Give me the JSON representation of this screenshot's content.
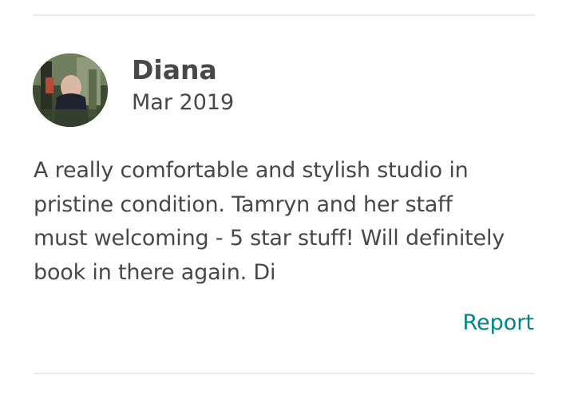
{
  "review": {
    "reviewer_name": "Diana",
    "date": "Mar 2019",
    "text_lines": [
      "A really comfortable and stylish studio in",
      "pristine condition. Tamryn and her staff",
      "must welcoming - 5 star stuff!  Will definitely",
      "book in there again. Di"
    ],
    "report_label": "Report"
  },
  "colors": {
    "text": "#484848",
    "link": "#008489",
    "divider": "#ebebeb"
  },
  "icons": {
    "avatar": "reviewer-avatar-photo"
  }
}
